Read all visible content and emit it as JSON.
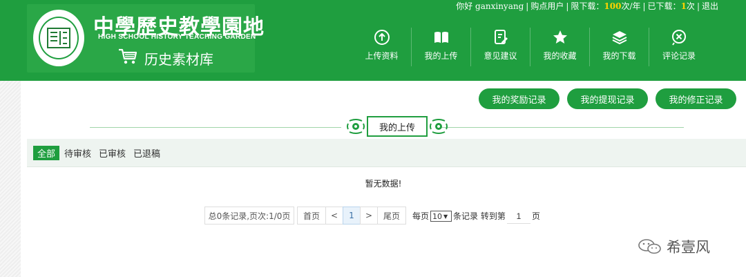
{
  "header": {
    "logo_seal": "中學歷史教學園地",
    "logo_title": "中學歷史教學園地",
    "logo_subtitle": "HIGH SCHOOL HISTORY TEACHING GARDEN",
    "logo_library": "历史素材库"
  },
  "userbar": {
    "greeting": "你好 ganxinyang",
    "buyer": "购点用户",
    "limit_label": "限下载：",
    "limit_value": "100",
    "limit_unit": "次/年",
    "downloaded_label": "已下载：",
    "downloaded_value": "1",
    "downloaded_unit": "次",
    "logout": "退出"
  },
  "nav": [
    {
      "label": "上传资料",
      "icon": "upload-icon"
    },
    {
      "label": "我的上传",
      "icon": "book-icon"
    },
    {
      "label": "意见建议",
      "icon": "edit-note-icon"
    },
    {
      "label": "我的收藏",
      "icon": "star-icon"
    },
    {
      "label": "我的下载",
      "icon": "layers-icon"
    },
    {
      "label": "评论记录",
      "icon": "close-circle-icon"
    }
  ],
  "record_buttons": {
    "reward": "我的奖励记录",
    "withdraw": "我的提现记录",
    "revise": "我的修正记录"
  },
  "section_title": "我的上传",
  "tabs": [
    {
      "label": "全部",
      "active": true
    },
    {
      "label": "待审核",
      "active": false
    },
    {
      "label": "已审核",
      "active": false
    },
    {
      "label": "已退稿",
      "active": false
    }
  ],
  "empty_message": "暂无数据!",
  "pagination": {
    "summary": "总0条记录,页次:1/0页",
    "first": "首页",
    "prev": "<",
    "current": "1",
    "next": ">",
    "last": "尾页",
    "per_page_label": "每页",
    "per_page_value": "10",
    "records_label": "条记录 转到第",
    "goto_value": "1",
    "page_label": "页"
  },
  "watermark": "希壹风",
  "colors": {
    "brand_green": "#1f9e3f",
    "highlight_yellow": "#ffd200"
  }
}
